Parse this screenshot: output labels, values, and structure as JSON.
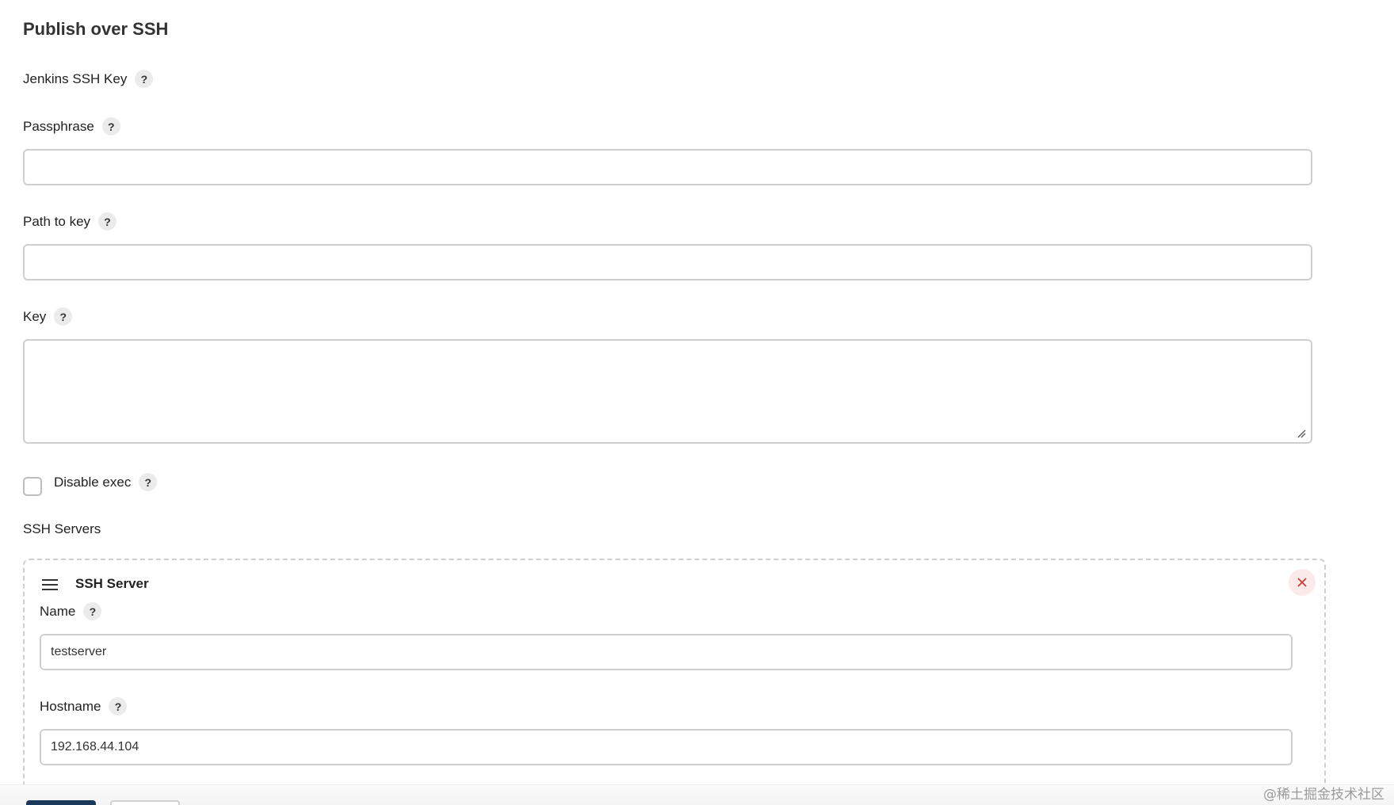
{
  "section": {
    "title": "Publish over SSH"
  },
  "help_glyph": "?",
  "jenkins_ssh_key": {
    "label": "Jenkins SSH Key"
  },
  "passphrase": {
    "label": "Passphrase",
    "value": ""
  },
  "path_to_key": {
    "label": "Path to key",
    "value": ""
  },
  "key": {
    "label": "Key",
    "value": ""
  },
  "disable_exec": {
    "label": "Disable exec",
    "checked": false
  },
  "ssh_servers": {
    "label": "SSH Servers",
    "server": {
      "title": "SSH Server",
      "name": {
        "label": "Name",
        "value": "testserver"
      },
      "hostname": {
        "label": "Hostname",
        "value": "192.168.44.104"
      }
    }
  },
  "watermark": "@稀土掘金技术社区",
  "colors": {
    "primary_button": "#1a3a5c",
    "close_accent": "#d33b3b",
    "border": "#cfcfcf"
  }
}
